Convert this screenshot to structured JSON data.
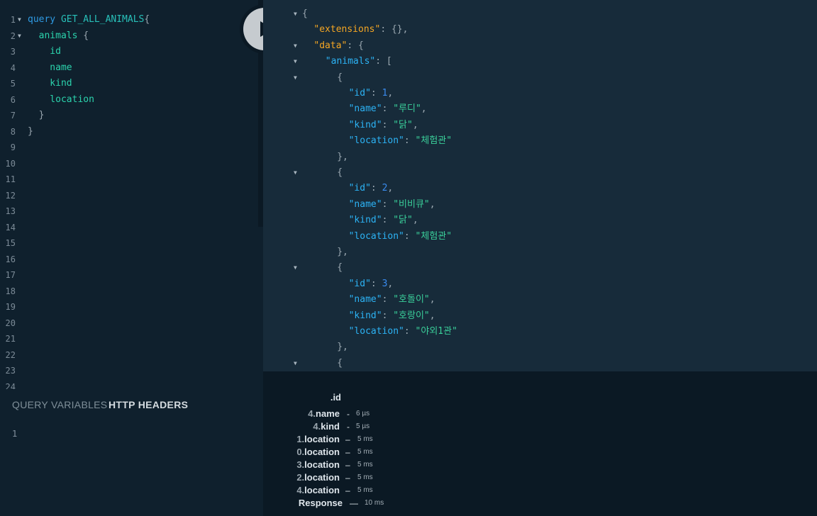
{
  "editor": {
    "line_numbers": [
      "1",
      "2",
      "3",
      "4",
      "5",
      "6",
      "7",
      "8",
      "9",
      "10",
      "11",
      "12",
      "13",
      "14",
      "15",
      "16",
      "17",
      "18",
      "19",
      "20",
      "21",
      "22",
      "23",
      "24"
    ],
    "query": {
      "keyword": "query",
      "name": "GET_ALL_ANIMALS",
      "open_brace": "{",
      "field": "animals",
      "subfields": [
        "id",
        "name",
        "kind",
        "location"
      ],
      "close_brace": "}"
    }
  },
  "run_button": {
    "icon": "play-icon"
  },
  "result": {
    "extensions_key": "\"extensions\"",
    "extensions_value": "{},",
    "data_key": "\"data\"",
    "animals_key": "\"animals\"",
    "animals": [
      {
        "id": "1",
        "name": "\"루디\"",
        "kind": "\"닭\"",
        "location": "\"체험관\""
      },
      {
        "id": "2",
        "name": "\"비비큐\"",
        "kind": "\"닭\"",
        "location": "\"체험관\""
      },
      {
        "id": "3",
        "name": "\"호돌이\"",
        "kind": "\"호랑이\"",
        "location": "\"야외1관\""
      }
    ],
    "keys": {
      "id": "\"id\"",
      "name": "\"name\"",
      "kind": "\"kind\"",
      "location": "\"location\""
    }
  },
  "bottom_tabs": {
    "query_variables": "QUERY VARIABLES",
    "http_headers": "HTTP HEADERS"
  },
  "variables_editor": {
    "line": "1"
  },
  "tracing": {
    "rows": [
      {
        "pre": "4.",
        "name": "name",
        "dash": "-",
        "time": "6 µs"
      },
      {
        "pre": "4.",
        "name": "kind",
        "dash": "-",
        "time": "5 µs"
      },
      {
        "pre": "1.",
        "name": "location",
        "dash": "–",
        "time": "5 ms"
      },
      {
        "pre": "0.",
        "name": "location",
        "dash": "–",
        "time": "5 ms"
      },
      {
        "pre": "3.",
        "name": "location",
        "dash": "–",
        "time": "5 ms"
      },
      {
        "pre": "2.",
        "name": "location",
        "dash": "–",
        "time": "5 ms"
      },
      {
        "pre": "4.",
        "name": "location",
        "dash": "–",
        "time": "5 ms"
      }
    ],
    "response": {
      "label": "Response",
      "dash": "—",
      "time": "10 ms"
    }
  }
}
